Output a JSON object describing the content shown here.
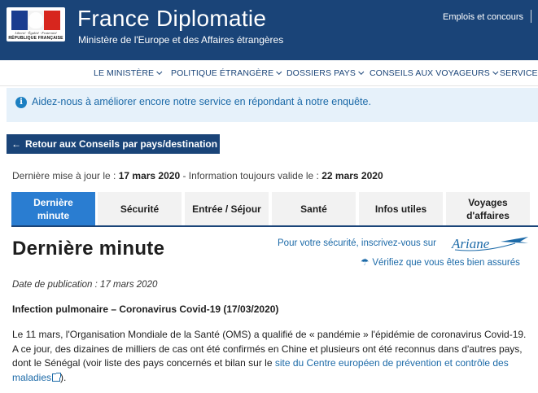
{
  "header": {
    "logo_motto": "Liberté · Égalité · Fraternité",
    "logo_text": "RÉPUBLIQUE FRANÇAISE",
    "title": "France Diplomatie",
    "subtitle": "Ministère de l'Europe et des Affaires étrangères",
    "top_link": "Emplois et concours",
    "brand_color": "#1a4478"
  },
  "nav": {
    "items": [
      {
        "label": "LE MINISTÈRE"
      },
      {
        "label": "POLITIQUE ÉTRANGÈRE"
      },
      {
        "label": "DOSSIERS PAYS"
      },
      {
        "label": "CONSEILS AUX VOYAGEURS"
      },
      {
        "label": "SERVICES"
      }
    ]
  },
  "banner": {
    "icon": "info-icon",
    "text": "Aidez-nous à améliorer encore notre service en répondant à notre enquête."
  },
  "back_button": {
    "label": "Retour aux Conseils par pays/destination"
  },
  "update": {
    "prefix": "Dernière mise à jour le : ",
    "date": "17 mars 2020",
    "middle": " - Information toujours valide le : ",
    "valid_date": "22 mars 2020"
  },
  "tabs": [
    {
      "label": "Dernière minute",
      "active": true
    },
    {
      "label": "Sécurité"
    },
    {
      "label": "Entrée / Séjour"
    },
    {
      "label": "Santé"
    },
    {
      "label": "Infos utiles"
    },
    {
      "label": "Voyages d'affaires"
    }
  ],
  "content": {
    "heading": "Dernière minute",
    "register_text": "Pour votre sécurité, inscrivez-vous sur",
    "ariane_logo": "Ariane",
    "insured_text": "Vérifiez que vous êtes bien assurés",
    "pub_date": "Date de publication : 17 mars 2020",
    "subtitle": "Infection pulmonaire – Coronavirus Covid-19 (17/03/2020)",
    "paragraph_text": "Le 11 mars, l'Organisation Mondiale de la Santé (OMS) a qualifié de « pandémie » l'épidémie de coronavirus Covid-19. A ce jour, des dizaines de milliers de cas ont été confirmés en Chine et plusieurs ont été reconnus dans d'autres pays, dont le Sénégal (voir liste des pays concernés et bilan sur le ",
    "paragraph_link": "site du Centre européen de prévention et contrôle des maladies",
    "paragraph_end": ")."
  }
}
